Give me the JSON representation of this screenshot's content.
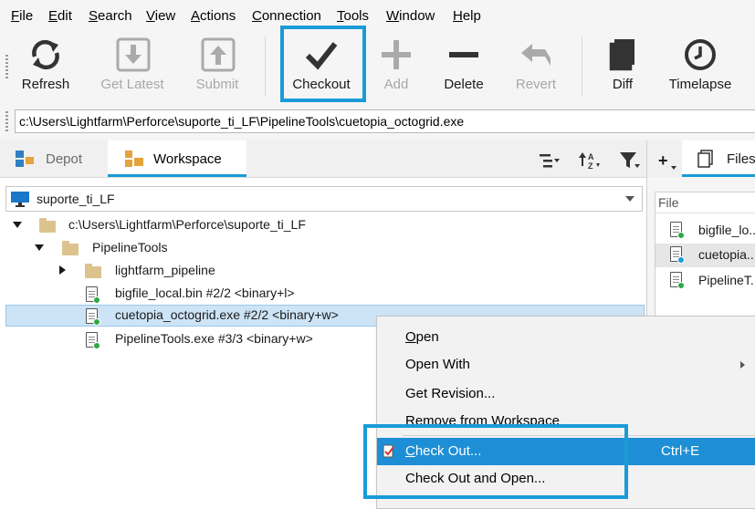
{
  "menubar": {
    "items": [
      {
        "label": "File",
        "u": "F",
        "rest": "ile"
      },
      {
        "label": "Edit",
        "u": "E",
        "rest": "dit"
      },
      {
        "label": "Search",
        "u": "S",
        "rest": "earch"
      },
      {
        "label": "View",
        "u": "V",
        "rest": "iew"
      },
      {
        "label": "Actions",
        "u": "A",
        "rest": "ctions"
      },
      {
        "label": "Connection",
        "u": "C",
        "rest": "onnection"
      },
      {
        "label": "Tools",
        "u": "T",
        "rest": "ools"
      },
      {
        "label": "Window",
        "u": "W",
        "rest": "indow"
      },
      {
        "label": "Help",
        "u": "H",
        "rest": "elp"
      }
    ]
  },
  "toolbar": {
    "refresh": "Refresh",
    "get_latest": "Get Latest",
    "submit": "Submit",
    "checkout": "Checkout",
    "add": "Add",
    "delete": "Delete",
    "revert": "Revert",
    "diff": "Diff",
    "timelapse": "Timelapse"
  },
  "path": "c:\\Users\\Lightfarm\\Perforce\\suporte_ti_LF\\PipelineTools\\cuetopia_octogrid.exe",
  "tabs": {
    "depot": "Depot",
    "workspace": "Workspace"
  },
  "workspace_selector": "suporte_ti_LF",
  "tree": {
    "root": "c:\\Users\\Lightfarm\\Perforce\\suporte_ti_LF",
    "folder": "PipelineTools",
    "subfolder": "lightfarm_pipeline",
    "files": [
      "bigfile_local.bin #2/2 <binary+l>",
      "cuetopia_octogrid.exe #2/2 <binary+w>",
      "PipelineTools.exe #3/3 <binary+w>"
    ]
  },
  "right_pane": {
    "tab_label": "Files",
    "column_header": "File",
    "files": [
      "bigfile_lo...",
      "cuetopia...",
      "PipelineT..."
    ]
  },
  "context_menu": {
    "items": [
      {
        "u": "O",
        "rest": "pen",
        "shortcut": ""
      },
      {
        "u": "",
        "rest": "Open With",
        "shortcut": ""
      },
      {
        "u": "",
        "rest": "Get Revision...",
        "shortcut": ""
      },
      {
        "u": "",
        "rest": "Remove from Workspace",
        "shortcut": ""
      },
      {
        "u": "C",
        "rest": "heck Out...",
        "shortcut": "Ctrl+E"
      },
      {
        "u": "",
        "rest": "Check Out and Open...",
        "shortcut": ""
      }
    ]
  },
  "colors": {
    "accent": "#1a9bd7",
    "menu_highlight": "#1e8fd6",
    "selection": "#cde4f7"
  }
}
